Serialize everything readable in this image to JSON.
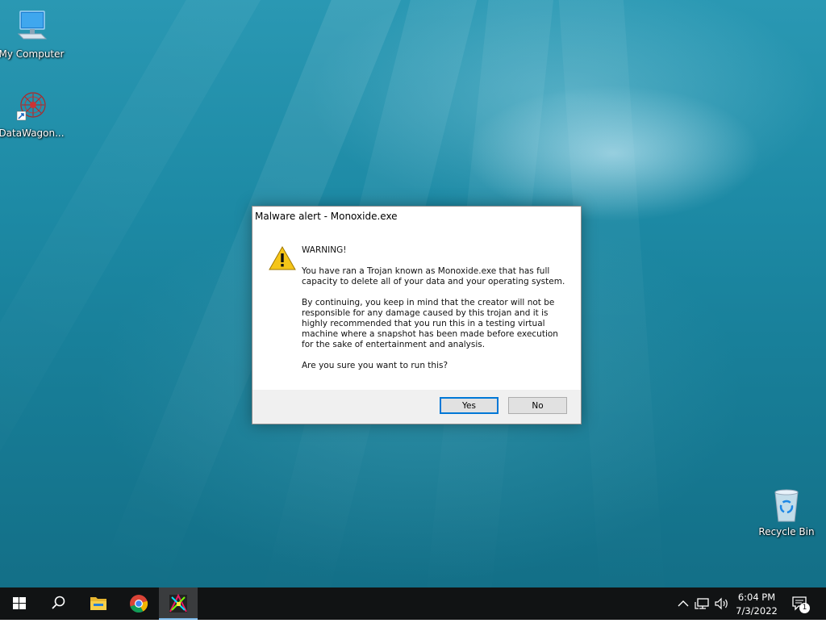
{
  "desktop": {
    "icons": [
      {
        "label": "My Computer",
        "icon": "computer-icon"
      },
      {
        "label": "DataWagon...",
        "icon": "datawagon-shortcut-icon"
      },
      {
        "label": "Recycle Bin",
        "icon": "recycle-bin-icon"
      }
    ]
  },
  "dialog": {
    "title": "Malware alert - Monoxide.exe",
    "icon": "warning-icon",
    "heading": "WARNING!",
    "paragraph1": "You have ran a Trojan known as Monoxide.exe that has full capacity to delete all of your data and your operating system.",
    "paragraph2": "By continuing, you keep in mind that the creator will not be responsible for any damage caused by this trojan and it is highly recommended that you run this in a testing virtual machine where a snapshot has been made before execution for the sake of entertainment and analysis.",
    "question": "Are you sure you want to run this?",
    "yes_label": "Yes",
    "no_label": "No"
  },
  "taskbar": {
    "items": [
      "start-icon",
      "search-icon",
      "file-explorer-icon",
      "chrome-icon",
      "monoxide-app-icon"
    ],
    "tray": {
      "icons": [
        "chevron-up-icon",
        "network-icon",
        "volume-icon"
      ],
      "time": "6:04 PM",
      "date": "7/3/2022",
      "notification_count": "1"
    }
  },
  "colors": {
    "accent": "#0078d7",
    "taskbar": "#111314",
    "desktop": "#1d8aa5"
  }
}
